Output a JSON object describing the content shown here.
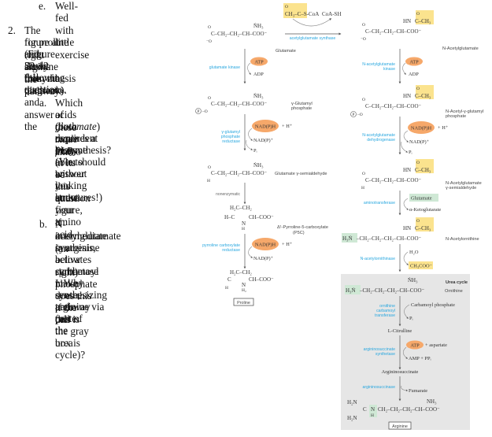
{
  "question_text": {
    "prev_item": {
      "marker": "e.",
      "text": "Well-fed with little exercise"
    },
    "q2": {
      "number": "2.",
      "lines": [
        "The figure at right shows the pathways",
        "for proline and arginine biosynthesis",
        "(Figure 22-12 from the textbook).",
        "Study this diagram and answer the",
        "following questions."
      ]
    },
    "part_a": {
      "marker": "a.",
      "line1": "Which of these two amino",
      "line2_pre": "acids (both ",
      "line2_em": "made from",
      "line3_em": "glutamate",
      "line3_post": ") requires a PLP-",
      "lines_rest": [
        "dependent enzyme in its",
        "biosynthesis?  (You should be",
        "able to answer this question",
        "without looking at the figure, if",
        "you know your amino acid",
        "structures!)"
      ]
    },
    "part_b": {
      "marker": "b.",
      "lines": [
        "N-acetylglutamate (an",
        "intermediate in arginine",
        "synthesis, below right)",
        "activates carbamoyl phosphate",
        "synthetase I.  Why does this",
        "make sense, if the cell is",
        "synthesizing arginine via this",
        "pathway (note: the gray box is",
        "part of the urea cycle)?"
      ]
    }
  },
  "figure": {
    "colors": {
      "enzyme": "#29a7df",
      "acetyl_highlight": "#fbe38e",
      "cofactor_oval": "#f6a86a",
      "amine_highlight": "#cfe8d5",
      "urea_box": "#e6e6e6"
    },
    "left_pathway": {
      "compounds": {
        "glutamate": "Glutamate",
        "gamma_glutamyl_phosphate_1": "γ-Glutamyl",
        "gamma_glutamyl_phosphate_2": "phosphate",
        "glutamate_semialdehyde": "Glutamate γ-semialdehyde",
        "p5c_1": "Δ¹-Pyrroline-5-carboxylate",
        "p5c_2": "(P5C)",
        "proline": "Proline"
      },
      "enzymes": {
        "glutamate_kinase": "glutamate kinase",
        "ggp_reductase_1": "γ-glutamyl",
        "ggp_reductase_2": "phosphate",
        "ggp_reductase_3": "reductase",
        "nonenzymatic": "nonenzymatic",
        "p5c_reductase_1": "pyrroline carboxylate",
        "p5c_reductase_2": "reductase"
      },
      "cofactors": {
        "atp": "ATP",
        "adp": "ADP",
        "nadph_1": "NAD(P)H",
        "h_plus_1": "+ H⁺",
        "nadp_1": "NAD(P)⁺",
        "pi_1": "Pᵢ",
        "nadph_2": "NAD(P)H",
        "h_plus_2": "+ H⁺",
        "nadp_2": "NAD(P)⁺"
      }
    },
    "top_reaction": {
      "acetyl_coa": "CH₃–C–S-CoA",
      "coa_sh": "CoA-SH",
      "enzyme": "acetylglutamate synthase"
    },
    "right_pathway": {
      "compounds": {
        "n_acetylglutamate": "N-Acetylglutamate",
        "n_acetyl_ggp_1": "N-Acetyl-γ-glutamyl",
        "n_acetyl_ggp_2": "phosphate",
        "n_acetyl_gsa_1": "N-Acetylglutamate",
        "n_acetyl_gsa_2": "γ-semialdehyde",
        "n_acetylornithine": "N-Acetylornithine",
        "ornithine": "Ornithine",
        "citrulline": "L-Citrulline",
        "argininosuccinate": "Argininosuccinate",
        "arginine": "Arginine"
      },
      "enzymes": {
        "nag_kinase_1": "N-acetylglutamate",
        "nag_kinase_2": "kinase",
        "nag_dehydrogenase_1": "N-acetylglutamate",
        "nag_dehydrogenase_2": "dehydrogenase",
        "aminotransferase": "aminotransferase",
        "n_acetylornithinase": "N-acetylornithinase",
        "otc_1": "ornithine",
        "otc_2": "carbamoyl",
        "otc_3": "transferase",
        "as_synthetase_1": "argininosuccinate",
        "as_synthetase_2": "synthetase",
        "as_lyase": "argininosuccinase"
      },
      "cofactors": {
        "atp": "ATP",
        "adp": "ADP",
        "nadph": "NAD(P)H",
        "h_plus": "+ H⁺",
        "nadp": "NAD(P)⁺",
        "pi_1": "Pᵢ",
        "glutamate": "Glutamate",
        "a_ketoglutarate": "α-Ketoglutarate",
        "water": "H₂O",
        "acetate": "CH₃COO⁻",
        "carbamoyl_phosphate": "Carbamoyl phosphate",
        "pi_2": "Pᵢ",
        "atp_2": "ATP",
        "aspartate": "+ aspartate",
        "amp_ppi": "AMP + PPᵢ",
        "fumarate": "Fumarate"
      },
      "urea_cycle_label": "Urea cycle"
    },
    "structure_text": {
      "nh3": "NH₃",
      "nh3_plus": "ṄH₃",
      "chain_glu": "C–CH₂–CH₂–CH–COO⁻",
      "o": "O",
      "o_minus": "⁻O",
      "h": "H",
      "p_group": "P",
      "hn": "HN",
      "acetyl": "C–CH₃",
      "ch": "CH",
      "coo": "COO⁻",
      "chain_orn": "–CH₂–CH₂–CH₂–CH–COO⁻",
      "h3n": "H₃Ṅ",
      "h2n": "H₂N",
      "ring_top": "H₂C–CH₂",
      "ring_hc": "H–C",
      "ring_ch": "CH–COO⁻",
      "ring_n": "N",
      "ring_nh": "H",
      "ring_nh2": "H₂",
      "arg_c": "C",
      "arg_nh": "N",
      "arg_h": "H",
      "arg_chain": "CH₂–CH₂–CH₂–CH–COO⁻"
    }
  }
}
